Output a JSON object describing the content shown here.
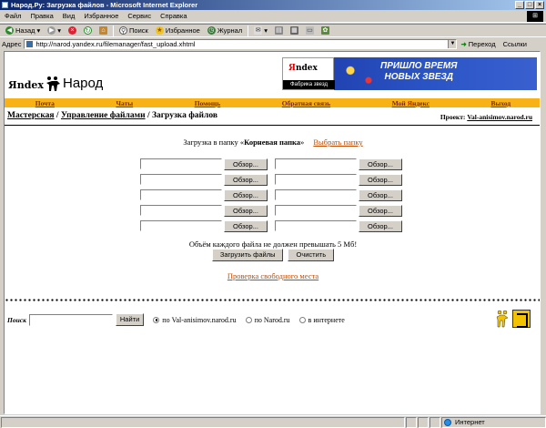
{
  "window": {
    "title": "Народ.Ру: Загрузка файлов - Microsoft Internet Explorer",
    "btn_min": "_",
    "btn_max": "□",
    "btn_close": "×"
  },
  "menu": [
    "Файл",
    "Правка",
    "Вид",
    "Избранное",
    "Сервис",
    "Справка"
  ],
  "toolbar": {
    "back": "Назад",
    "search": "Поиск",
    "favorites": "Избранное",
    "journal": "Журнал"
  },
  "address": {
    "label": "Адрес",
    "url": "http://narod.yandex.ru/filemanager/fast_upload.xhtml",
    "go": "Переход",
    "links": "Ссылки"
  },
  "logo": {
    "yandex": "Яndex",
    "narod": "Народ"
  },
  "banner": {
    "yandex_logo": "Яndex",
    "subtitle": "Фабрика звезд",
    "line1": "ПРИШЛО ВРЕМЯ",
    "line2": "НОВЫХ ЗВЕЗД"
  },
  "nav": [
    "Почта",
    "Чаты",
    "Помощь",
    "Обратная связь",
    "Мой Яндекс",
    "Выход"
  ],
  "breadcrumb": {
    "item1": "Мастерская",
    "sep": " / ",
    "item2": "Управление файлами",
    "item3": "Загрузка файлов"
  },
  "project": {
    "label": "Проект: ",
    "name": "Val-anisimov.narod.ru"
  },
  "upload": {
    "text": "Загрузка в папку «",
    "folder": "Корневая папка",
    "text_end": "»",
    "choose": "Выбрать папку"
  },
  "browse_label": "Обзор...",
  "limit_text": "Объём каждого файла не должен превышать 5 Мб!",
  "buttons": {
    "upload": "Загрузить файлы",
    "clear": "Очистить"
  },
  "check_space": "Проверка свободного места",
  "search": {
    "label": "Поиск",
    "button": "Найти",
    "opt1": "по Val-anisimov.narod.ru",
    "opt2": "по Narod.ru",
    "opt3": "в интернете"
  },
  "status": {
    "zone": "Интернет"
  }
}
